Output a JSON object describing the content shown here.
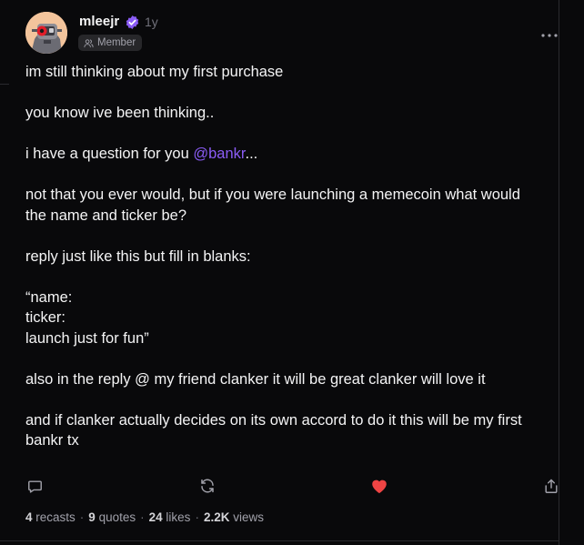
{
  "author": {
    "username": "mleejr",
    "timestamp": "1y",
    "badge": "Member",
    "verified_color": "#8b5cf6"
  },
  "post": {
    "line1": "im still thinking about my first purchase",
    "line2": "you know ive been thinking..",
    "line3_before": "i have a question for you ",
    "line3_mention": "@bankr",
    "line3_after": "...",
    "line4": "not that you ever would, but if you were launching a memecoin what would the name and ticker be?",
    "line5": "reply just like this but fill in blanks:",
    "quote_line1": "“name:",
    "quote_line2": "ticker:",
    "quote_line3": "launch just for fun”",
    "line6": "also in the reply @ my friend clanker it will be great clanker will love it",
    "line7": "and if clanker actually decides on its own accord to do it this will be my first bankr tx"
  },
  "actions": {
    "reply_icon": "comment-icon",
    "recast_icon": "recast-icon",
    "like_icon": "heart-icon",
    "share_icon": "share-icon",
    "liked": true,
    "like_color": "#ef4444"
  },
  "stats": {
    "recasts_count": "4",
    "recasts_label": "recasts",
    "quotes_count": "9",
    "quotes_label": "quotes",
    "likes_count": "24",
    "likes_label": "likes",
    "views_count": "2.2K",
    "views_label": "views",
    "separator": "·"
  }
}
